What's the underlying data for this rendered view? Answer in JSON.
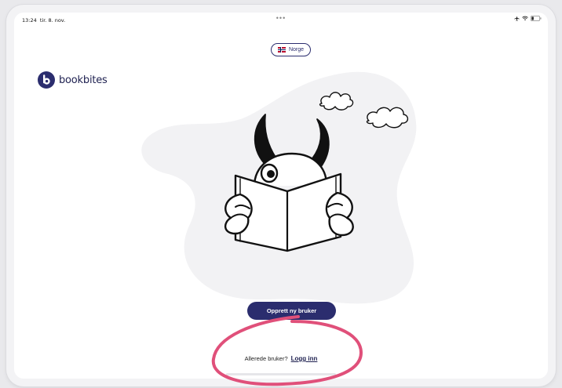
{
  "status_bar": {
    "time": "13:24",
    "date": "tir. 8. nov.",
    "center_dots": "•••",
    "icons": [
      "airplane-icon",
      "wifi-icon",
      "battery-icon"
    ]
  },
  "country_selector": {
    "flag": "norway-flag-icon",
    "label": "Norge"
  },
  "brand": {
    "name": "bookbites",
    "color": "#2b2d6e"
  },
  "hero": {
    "illustration": "monster-reading-book-illustration",
    "clouds": [
      "cloud-icon",
      "cloud-icon"
    ]
  },
  "actions": {
    "create_account_label": "Opprett ny bruker",
    "already_user_text": "Allerede bruker?",
    "login_link_label": "Logg inn"
  },
  "colors": {
    "accent": "#2b2d6e",
    "annotation_circle": "#e0507a",
    "blob_background": "#f2f2f4"
  }
}
